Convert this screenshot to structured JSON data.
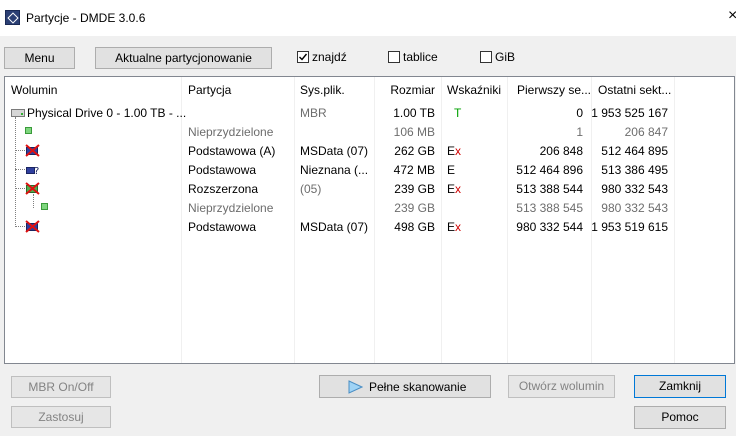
{
  "window": {
    "title": "Partycje - DMDE 3.0.6",
    "close_glyph": "×"
  },
  "toolbar": {
    "menu_label": "Menu",
    "current_partitioning_label": "Aktualne partycjonowanie",
    "find_label": "znajdź",
    "find_checked": true,
    "tables_label": "tablice",
    "tables_checked": false,
    "gib_label": "GiB",
    "gib_checked": false
  },
  "table": {
    "columns": [
      "Wolumin",
      "Partycja",
      "Sys.plik.",
      "Rozmiar",
      "Wskaźniki",
      "Pierwszy se...",
      "Ostatni sekt..."
    ],
    "rows": [
      {
        "volume": "Physical Drive 0 - 1.00 TB - ...",
        "partition": "",
        "fs": "MBR",
        "size": "1.00 TB",
        "flag1": "T",
        "flag2": "",
        "first": "0",
        "last": "1 953 525 167",
        "icon": "drive-icon",
        "muted": false,
        "fs_muted": true
      },
      {
        "volume": "",
        "partition": "Nieprzydzielone",
        "fs": "",
        "size": "106 MB",
        "flag1": "",
        "flag2": "",
        "first": "1",
        "last": "206 847",
        "icon": "unallocated-icon",
        "muted": true,
        "fs_muted": false
      },
      {
        "volume": "",
        "partition": "Podstawowa (A)",
        "fs": "MSData (07)",
        "size": "262 GB",
        "flag1": "E",
        "flag2": "x",
        "first": "206 848",
        "last": "512 464 895",
        "icon": "partition-error-icon",
        "muted": false,
        "fs_muted": false
      },
      {
        "volume": "",
        "partition": "Podstawowa",
        "fs": "Nieznana (...",
        "size": "472 MB",
        "flag1": "E",
        "flag2": "",
        "first": "512 464 896",
        "last": "513 386 495",
        "icon": "partition-unknown-icon",
        "muted": false,
        "fs_muted": false
      },
      {
        "volume": "",
        "partition": "Rozszerzona",
        "fs": "(05)",
        "size": "239 GB",
        "flag1": "E",
        "flag2": "x",
        "first": "513 388 544",
        "last": "980 332 543",
        "icon": "partition-extended-icon",
        "muted": false,
        "fs_muted": true
      },
      {
        "volume": "",
        "partition": "Nieprzydzielone",
        "fs": "",
        "size": "239 GB",
        "flag1": "",
        "flag2": "",
        "first": "513 388 545",
        "last": "980 332 543",
        "icon": "unallocated-icon",
        "muted": true,
        "fs_muted": false
      },
      {
        "volume": "",
        "partition": "Podstawowa",
        "fs": "MSData (07)",
        "size": "498 GB",
        "flag1": "E",
        "flag2": "x",
        "first": "980 332 544",
        "last": "1 953 519 615",
        "icon": "partition-error-icon",
        "muted": false,
        "fs_muted": false
      }
    ]
  },
  "buttons": {
    "mbr_onoff": "MBR On/Off",
    "apply": "Zastosuj",
    "full_scan": "Pełne skanowanie",
    "open_volume": "Otwórz wolumin",
    "close": "Zamknij",
    "help": "Pomoc"
  },
  "colors": {
    "flag_t": "#00a000",
    "flag_x": "#d00000",
    "focus": "#0078d7"
  }
}
